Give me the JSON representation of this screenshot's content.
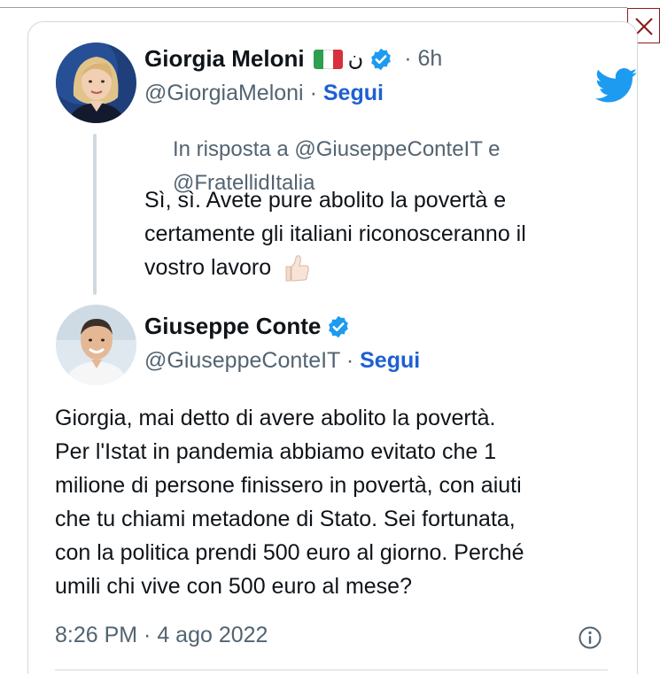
{
  "close_button": {
    "label": "close",
    "icon": "close-icon"
  },
  "quoted_tweet": {
    "author_name": "Giorgia Meloni",
    "flag": "Italy",
    "arabic_char": "ن",
    "verified": true,
    "separator": "·",
    "time": "6h",
    "handle": "@GiorgiaMeloni",
    "follow_label": "Segui",
    "reply_line_1": "In risposta a @GiuseppeConteIT e",
    "reply_line_2": "@FratellidItalia",
    "text_line_1": "Sì, sì. Avete pure abolito la povertà e",
    "text_line_2": "certamente gli italiani riconosceranno il",
    "text_line_3": "vostro lavoro",
    "emoji": "thumbs-up"
  },
  "main_tweet": {
    "author_name": "Giuseppe Conte",
    "verified": true,
    "handle": "@GiuseppeConteIT",
    "separator": "·",
    "follow_label": "Segui",
    "text_lines": [
      "Giorgia, mai detto di avere abolito la povertà.",
      "Per l'Istat in pandemia abbiamo evitato che 1",
      "milione di persone finissero in povertà, con aiuti",
      "che tu chiami metadone di Stato. Sei fortunata,",
      "con la politica prendi 500 euro al giorno. Perché",
      "umili chi vive con 500 euro al mese?"
    ],
    "timestamp": "8:26 PM · 4 ago 2022"
  },
  "colors": {
    "link_blue": "#1d60d2",
    "twitter_blue": "#1d9bf0",
    "secondary_text": "#536471",
    "border": "#cfd9de"
  },
  "icons": {
    "brand": "twitter-bird-icon",
    "verified": "verified-badge-icon",
    "info": "info-icon"
  }
}
